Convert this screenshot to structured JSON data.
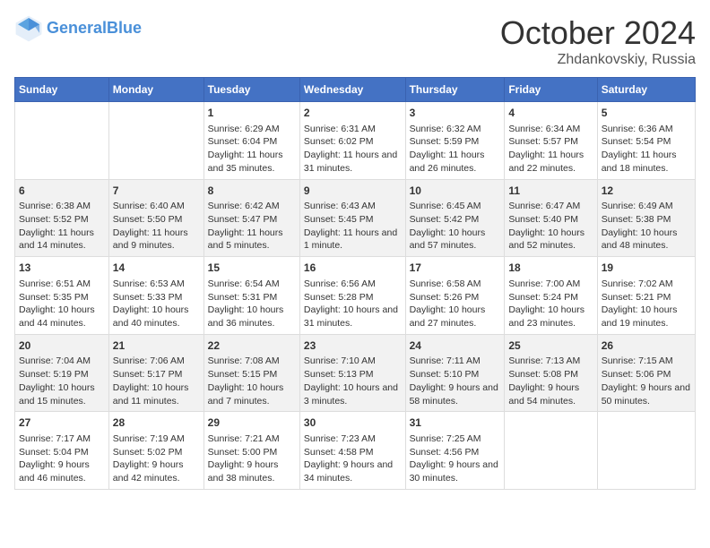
{
  "header": {
    "logo_line1": "General",
    "logo_line2": "Blue",
    "month": "October 2024",
    "location": "Zhdankovskiy, Russia"
  },
  "days_of_week": [
    "Sunday",
    "Monday",
    "Tuesday",
    "Wednesday",
    "Thursday",
    "Friday",
    "Saturday"
  ],
  "weeks": [
    [
      {
        "day": "",
        "content": ""
      },
      {
        "day": "",
        "content": ""
      },
      {
        "day": "1",
        "content": "Sunrise: 6:29 AM\nSunset: 6:04 PM\nDaylight: 11 hours and 35 minutes."
      },
      {
        "day": "2",
        "content": "Sunrise: 6:31 AM\nSunset: 6:02 PM\nDaylight: 11 hours and 31 minutes."
      },
      {
        "day": "3",
        "content": "Sunrise: 6:32 AM\nSunset: 5:59 PM\nDaylight: 11 hours and 26 minutes."
      },
      {
        "day": "4",
        "content": "Sunrise: 6:34 AM\nSunset: 5:57 PM\nDaylight: 11 hours and 22 minutes."
      },
      {
        "day": "5",
        "content": "Sunrise: 6:36 AM\nSunset: 5:54 PM\nDaylight: 11 hours and 18 minutes."
      }
    ],
    [
      {
        "day": "6",
        "content": "Sunrise: 6:38 AM\nSunset: 5:52 PM\nDaylight: 11 hours and 14 minutes."
      },
      {
        "day": "7",
        "content": "Sunrise: 6:40 AM\nSunset: 5:50 PM\nDaylight: 11 hours and 9 minutes."
      },
      {
        "day": "8",
        "content": "Sunrise: 6:42 AM\nSunset: 5:47 PM\nDaylight: 11 hours and 5 minutes."
      },
      {
        "day": "9",
        "content": "Sunrise: 6:43 AM\nSunset: 5:45 PM\nDaylight: 11 hours and 1 minute."
      },
      {
        "day": "10",
        "content": "Sunrise: 6:45 AM\nSunset: 5:42 PM\nDaylight: 10 hours and 57 minutes."
      },
      {
        "day": "11",
        "content": "Sunrise: 6:47 AM\nSunset: 5:40 PM\nDaylight: 10 hours and 52 minutes."
      },
      {
        "day": "12",
        "content": "Sunrise: 6:49 AM\nSunset: 5:38 PM\nDaylight: 10 hours and 48 minutes."
      }
    ],
    [
      {
        "day": "13",
        "content": "Sunrise: 6:51 AM\nSunset: 5:35 PM\nDaylight: 10 hours and 44 minutes."
      },
      {
        "day": "14",
        "content": "Sunrise: 6:53 AM\nSunset: 5:33 PM\nDaylight: 10 hours and 40 minutes."
      },
      {
        "day": "15",
        "content": "Sunrise: 6:54 AM\nSunset: 5:31 PM\nDaylight: 10 hours and 36 minutes."
      },
      {
        "day": "16",
        "content": "Sunrise: 6:56 AM\nSunset: 5:28 PM\nDaylight: 10 hours and 31 minutes."
      },
      {
        "day": "17",
        "content": "Sunrise: 6:58 AM\nSunset: 5:26 PM\nDaylight: 10 hours and 27 minutes."
      },
      {
        "day": "18",
        "content": "Sunrise: 7:00 AM\nSunset: 5:24 PM\nDaylight: 10 hours and 23 minutes."
      },
      {
        "day": "19",
        "content": "Sunrise: 7:02 AM\nSunset: 5:21 PM\nDaylight: 10 hours and 19 minutes."
      }
    ],
    [
      {
        "day": "20",
        "content": "Sunrise: 7:04 AM\nSunset: 5:19 PM\nDaylight: 10 hours and 15 minutes."
      },
      {
        "day": "21",
        "content": "Sunrise: 7:06 AM\nSunset: 5:17 PM\nDaylight: 10 hours and 11 minutes."
      },
      {
        "day": "22",
        "content": "Sunrise: 7:08 AM\nSunset: 5:15 PM\nDaylight: 10 hours and 7 minutes."
      },
      {
        "day": "23",
        "content": "Sunrise: 7:10 AM\nSunset: 5:13 PM\nDaylight: 10 hours and 3 minutes."
      },
      {
        "day": "24",
        "content": "Sunrise: 7:11 AM\nSunset: 5:10 PM\nDaylight: 9 hours and 58 minutes."
      },
      {
        "day": "25",
        "content": "Sunrise: 7:13 AM\nSunset: 5:08 PM\nDaylight: 9 hours and 54 minutes."
      },
      {
        "day": "26",
        "content": "Sunrise: 7:15 AM\nSunset: 5:06 PM\nDaylight: 9 hours and 50 minutes."
      }
    ],
    [
      {
        "day": "27",
        "content": "Sunrise: 7:17 AM\nSunset: 5:04 PM\nDaylight: 9 hours and 46 minutes."
      },
      {
        "day": "28",
        "content": "Sunrise: 7:19 AM\nSunset: 5:02 PM\nDaylight: 9 hours and 42 minutes."
      },
      {
        "day": "29",
        "content": "Sunrise: 7:21 AM\nSunset: 5:00 PM\nDaylight: 9 hours and 38 minutes."
      },
      {
        "day": "30",
        "content": "Sunrise: 7:23 AM\nSunset: 4:58 PM\nDaylight: 9 hours and 34 minutes."
      },
      {
        "day": "31",
        "content": "Sunrise: 7:25 AM\nSunset: 4:56 PM\nDaylight: 9 hours and 30 minutes."
      },
      {
        "day": "",
        "content": ""
      },
      {
        "day": "",
        "content": ""
      }
    ]
  ]
}
